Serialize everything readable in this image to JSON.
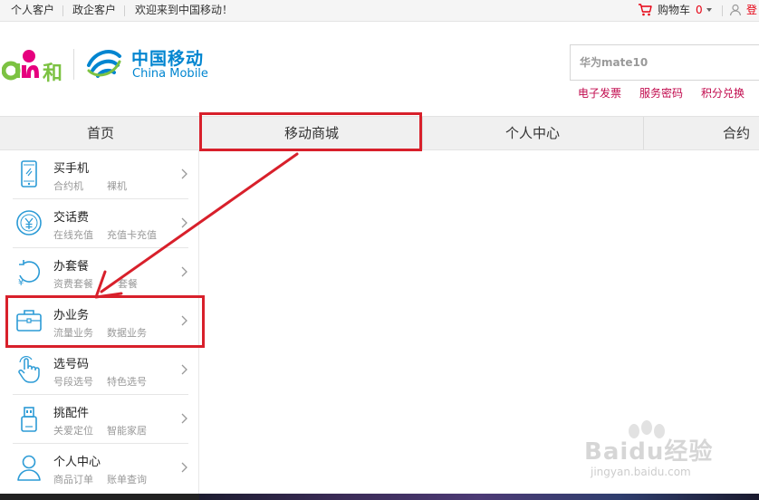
{
  "topbar": {
    "links": [
      "个人客户",
      "政企客户",
      "欢迎来到中国移动！"
    ],
    "cart_label": "购物车",
    "cart_count": "0",
    "login_label": "登"
  },
  "header": {
    "brand_text": "and和",
    "logo_cn": "中国移动",
    "logo_en": "China Mobile",
    "search_placeholder": "华为mate10",
    "quick_links": [
      "电子发票",
      "服务密码",
      "积分兑换"
    ]
  },
  "nav": {
    "tabs": [
      "首页",
      "移动商城",
      "个人中心",
      "合约"
    ]
  },
  "sidebar": {
    "items": [
      {
        "title": "买手机",
        "subs": [
          "合约机",
          "裸机"
        ],
        "icon": "phone-icon"
      },
      {
        "title": "交话费",
        "subs": [
          "在线充值",
          "充值卡充值"
        ],
        "icon": "yuan-coin-icon"
      },
      {
        "title": "办套餐",
        "subs": [
          "资费套餐",
          "套餐"
        ],
        "icon": "package-refresh-icon"
      },
      {
        "title": "办业务",
        "subs": [
          "流量业务",
          "数据业务"
        ],
        "icon": "briefcase-icon"
      },
      {
        "title": "选号码",
        "subs": [
          "号段选号",
          "特色选号"
        ],
        "icon": "touch-hand-icon"
      },
      {
        "title": "挑配件",
        "subs": [
          "关爱定位",
          "智能家居"
        ],
        "icon": "usb-accessory-icon"
      },
      {
        "title": "个人中心",
        "subs": [
          "商品订单",
          "账单查询"
        ],
        "icon": "user-icon"
      }
    ]
  },
  "watermark": {
    "main": "Baidu经验",
    "sub": "jingyan.baidu.com"
  },
  "colors": {
    "brand_blue": "#0085d0",
    "accent_red": "#e60012",
    "link_magenta": "#c10a4d",
    "annotation_red": "#d8202b"
  }
}
